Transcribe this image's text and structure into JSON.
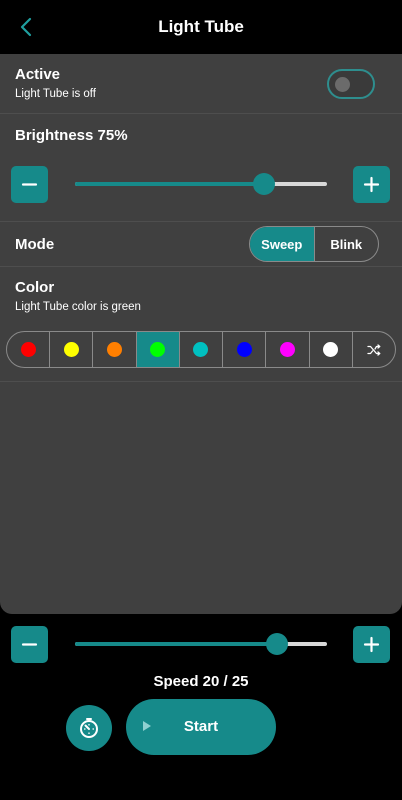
{
  "header": {
    "title": "Light Tube",
    "back_icon": "chevron-left-icon"
  },
  "active": {
    "label": "Active",
    "status": "Light Tube is off",
    "on": false
  },
  "brightness": {
    "label": "Brightness 75%",
    "value_percent": 75
  },
  "mode": {
    "label": "Mode",
    "options": [
      "Sweep",
      "Blink"
    ],
    "selected": "Sweep"
  },
  "color": {
    "label": "Color",
    "status": "Light Tube color is green",
    "swatches": [
      "#ff0000",
      "#ffff00",
      "#ff7f00",
      "#00ff00",
      "#00c0c0",
      "#0000ff",
      "#ff00ff",
      "#ffffff"
    ],
    "selected_index": 3,
    "random_icon": "shuffle-icon"
  },
  "speed": {
    "label": "Speed 20 / 25",
    "value": 20,
    "max": 25
  },
  "controls": {
    "start_label": "Start",
    "timer_icon": "timer-icon",
    "play_icon": "play-icon"
  },
  "colors": {
    "accent": "#168a8a",
    "panel": "#404040",
    "background": "#000000"
  }
}
